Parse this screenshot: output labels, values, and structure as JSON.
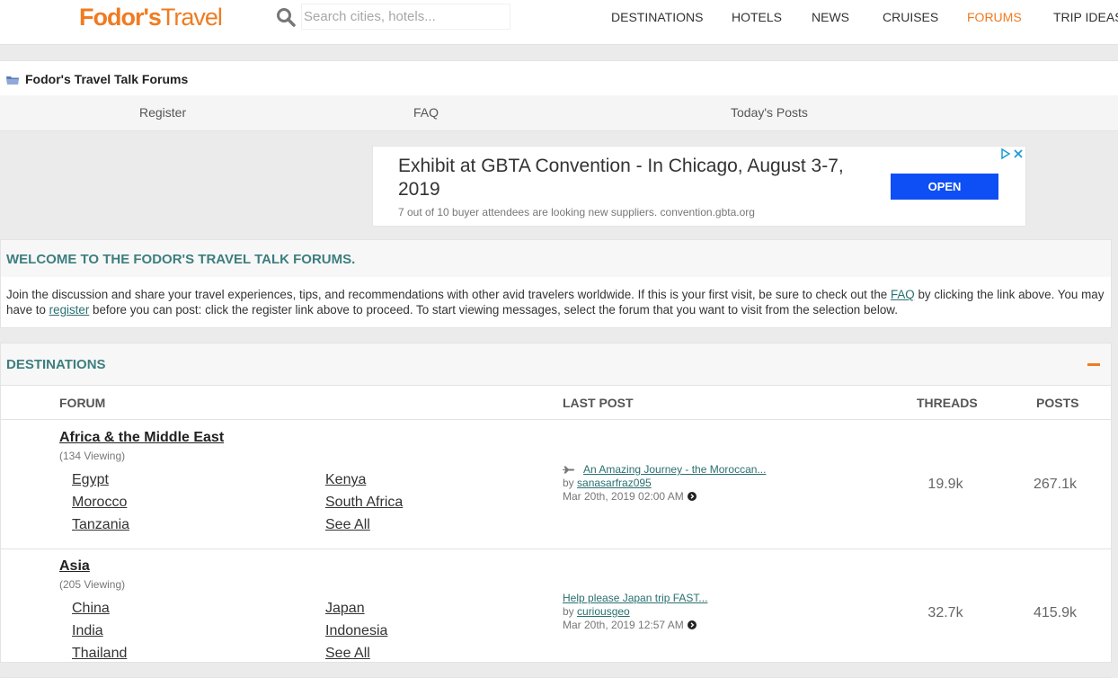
{
  "header": {
    "logo_bold": "Fodor's",
    "logo_rest": "Travel",
    "search_placeholder": "Search cities, hotels...",
    "nav": [
      "DESTINATIONS",
      "HOTELS",
      "NEWS",
      "CRUISES",
      "FORUMS",
      "TRIP IDEAS"
    ],
    "active_nav": "FORUMS",
    "accent_color": "#f07b20"
  },
  "breadcrumb": {
    "title": "Fodor's Travel Talk Forums"
  },
  "subnav": [
    "Register",
    "FAQ",
    "Today's Posts"
  ],
  "ad": {
    "title": "Exhibit at GBTA Convention - In Chicago, August 3-7, 2019",
    "subtitle": "7 out of 10 buyer attendees are looking new suppliers. convention.gbta.org",
    "button": "OPEN",
    "button_color": "#0e4ff5"
  },
  "welcome": {
    "title": "WELCOME TO THE FODOR'S TRAVEL TALK FORUMS.",
    "text_1": "Join the discussion and share your travel experiences, tips, and recommendations with other avid travelers worldwide. If this is your first visit, be sure to check out the ",
    "faq_link": "FAQ",
    "text_2": " by clicking the link above. You may have to ",
    "register_link": "register",
    "text_3": " before you can post: click the register link above to proceed. To start viewing messages, select the forum that you want to visit from the selection below."
  },
  "destinations": {
    "title": "DESTINATIONS",
    "columns": {
      "forum": "FORUM",
      "last_post": "LAST POST",
      "threads": "THREADS",
      "posts": "POSTS"
    },
    "forums": [
      {
        "name": "Africa & the Middle East",
        "viewing": "(134 Viewing)",
        "subforums": [
          "Egypt",
          "Kenya",
          "Morocco",
          "South Africa",
          "Tanzania",
          "See All"
        ],
        "last_post": {
          "title": "An Amazing Journey - the Moroccan...",
          "by": "by ",
          "user": "sanasarfraz095",
          "date": "Mar 20th, 2019 02:00 AM"
        },
        "threads": "19.9k",
        "posts": "267.1k"
      },
      {
        "name": "Asia",
        "viewing": "(205 Viewing)",
        "subforums": [
          "China",
          "Japan",
          "India",
          "Indonesia",
          "Thailand",
          "See All"
        ],
        "last_post": {
          "title": "Help please Japan trip FAST...",
          "by": "by ",
          "user": "curiousgeo",
          "date": "Mar 20th, 2019 12:57 AM"
        },
        "threads": "32.7k",
        "posts": "415.9k"
      }
    ]
  }
}
